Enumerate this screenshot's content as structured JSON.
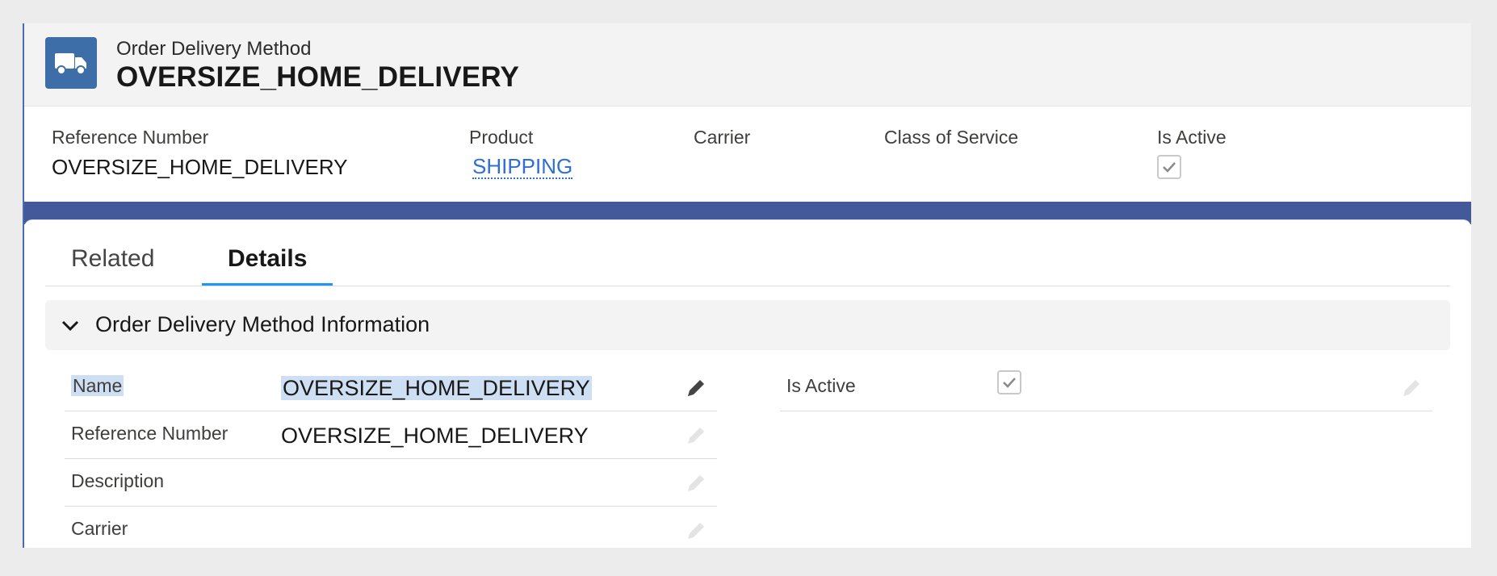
{
  "header": {
    "object_label": "Order Delivery Method",
    "record_title": "OVERSIZE_HOME_DELIVERY",
    "icon": "truck-icon"
  },
  "highlights": {
    "fields": [
      {
        "label": "Reference Number",
        "value": "OVERSIZE_HOME_DELIVERY"
      },
      {
        "label": "Product",
        "value": "SHIPPING"
      },
      {
        "label": "Carrier",
        "value": ""
      },
      {
        "label": "Class of Service",
        "value": ""
      },
      {
        "label": "Is Active",
        "value": true
      }
    ]
  },
  "tabs": [
    {
      "label": "Related",
      "active": false
    },
    {
      "label": "Details",
      "active": true
    }
  ],
  "section": {
    "title": "Order Delivery Method Information",
    "left_fields": [
      {
        "label": "Name",
        "value": "OVERSIZE_HOME_DELIVERY",
        "editable": true
      },
      {
        "label": "Reference Number",
        "value": "OVERSIZE_HOME_DELIVERY",
        "editable": false
      },
      {
        "label": "Description",
        "value": "",
        "editable": false
      },
      {
        "label": "Carrier",
        "value": "",
        "editable": false
      }
    ],
    "right_fields": [
      {
        "label": "Is Active",
        "value": true,
        "editable": false
      }
    ]
  },
  "colors": {
    "accent": "#1b96ff",
    "link": "#2e6fd3",
    "icon_bg": "#3e6ea8",
    "band": "#44599a"
  }
}
